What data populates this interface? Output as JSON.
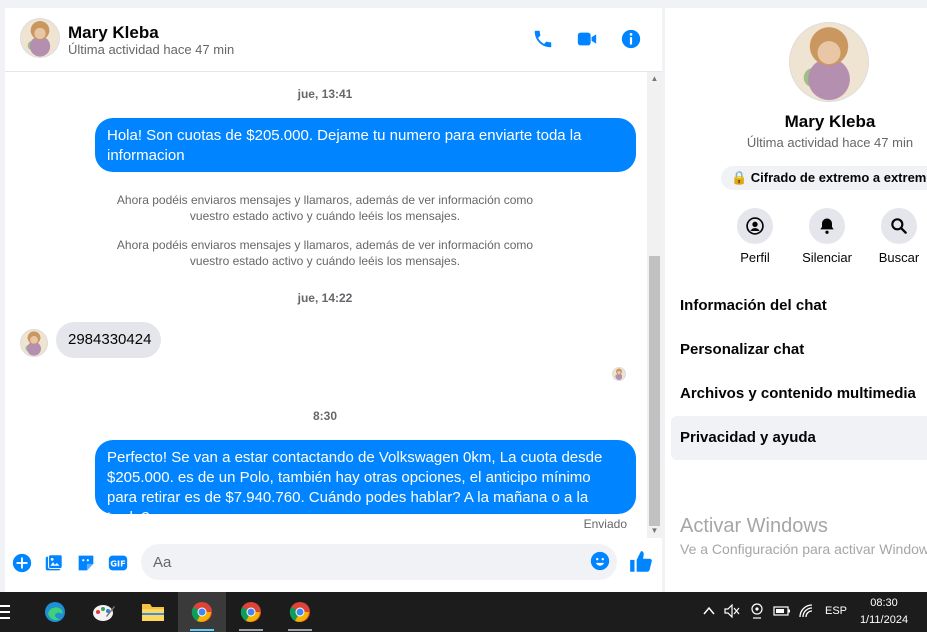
{
  "header": {
    "name": "Mary Kleba",
    "status": "Última actividad hace 47 min"
  },
  "messages": {
    "ts1": "jue, 13:41",
    "msg1": "Hola! Son cuotas de $205.000. Dejame tu numero para enviarte toda la informacion",
    "note1": "Ahora podéis enviaros mensajes y llamaros, además de ver información como vuestro estado activo y cuándo leéis los mensajes.",
    "note2": "Ahora podéis enviaros mensajes y llamaros, además de ver información como vuestro estado activo y cuándo leéis los mensajes.",
    "ts2": "jue, 14:22",
    "msg2": "2984330424",
    "ts3": "8:30",
    "msg3": "Perfecto!  Se van a estar contactando de Volkswagen 0km, La cuota desde $205.000. es de un Polo, también hay otras opciones, el anticipo mínimo para retirar es de $7.940.760. Cuándo podes hablar? A la mañana o a la tarde?",
    "sent_status": "Enviado"
  },
  "composer": {
    "placeholder": "Aa"
  },
  "info": {
    "name": "Mary Kleba",
    "status": "Última actividad hace 47 min",
    "encryption": "🔒 Cifrado de extremo a extremo",
    "actions": [
      "Perfil",
      "Silenciar",
      "Buscar"
    ],
    "menu": [
      "Información del chat",
      "Personalizar chat",
      "Archivos y contenido multimedia",
      "Privacidad y ayuda"
    ]
  },
  "watermark": {
    "title": "Activar Windows",
    "subtitle": "Ve a Configuración para activar Windows."
  },
  "taskbar": {
    "lang": "ESP",
    "time": "08:30",
    "date": "1/11/2024"
  },
  "colors": {
    "accent": "#0084ff",
    "incoming": "#e4e6eb"
  }
}
